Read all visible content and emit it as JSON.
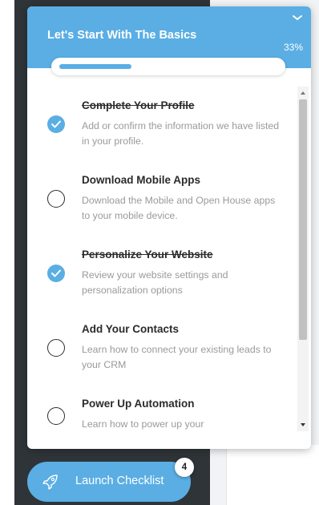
{
  "checklist": {
    "title": "Let's Start With The Basics",
    "percent": "33%",
    "progress_fraction": 0.33,
    "items": [
      {
        "title": "Complete Your Profile",
        "desc": "Add or confirm the information we have listed in your profile.",
        "completed": true
      },
      {
        "title": "Download Mobile Apps",
        "desc": "Download the Mobile and Open House apps to your mobile device.",
        "completed": false
      },
      {
        "title": "Personalize Your Website",
        "desc": "Review your website settings and personalization options",
        "completed": true
      },
      {
        "title": "Add Your Contacts",
        "desc": "Learn how to connect your existing leads to your CRM",
        "completed": false
      },
      {
        "title": "Power Up Automation",
        "desc": "Learn how to power up your",
        "completed": false
      }
    ]
  },
  "launch": {
    "label": "Launch Checklist",
    "badge": "4"
  },
  "icons": {
    "collapse": "chevron-down-icon",
    "check": "checkmark-icon",
    "rocket": "rocket-icon"
  },
  "colors": {
    "accent": "#5aaee3",
    "text_dark": "#2b2b2b",
    "text_muted": "#9a9a9a"
  }
}
